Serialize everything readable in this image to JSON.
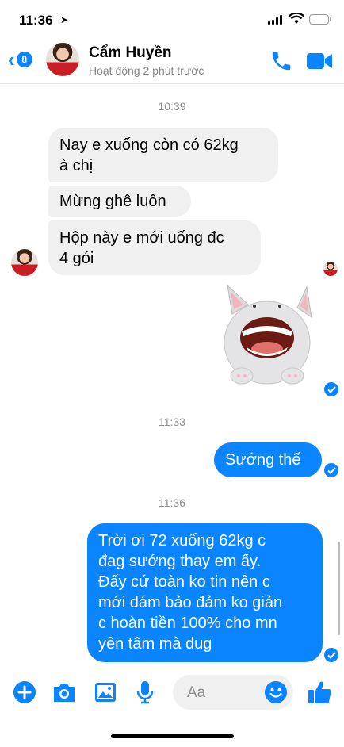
{
  "status_bar": {
    "time": "11:36"
  },
  "header": {
    "back_badge": "8",
    "contact_name": "Cẩm Huyền",
    "contact_status": "Hoạt động 2 phút trước"
  },
  "messages": {
    "timestamp_1": "10:39",
    "recv_1_line1": "Nay e xuống còn có 62kg",
    "recv_1_line2": "à chị",
    "recv_2": "Mừng ghê luôn",
    "recv_3_line1": "Hộp này e mới uống đc",
    "recv_3_line2": "4 gói",
    "timestamp_2": "11:33",
    "sent_1": "Sướng thế",
    "timestamp_3": "11:36",
    "sent_2_lines": [
      "Trời ơi 72 xuống 62kg c",
      "đag sướng thay em ấy.",
      "Đấy cứ toàn ko tin nên c",
      "mới dám bảo đảm ko giản",
      "c hoàn tiền 100% cho mn",
      "yên tâm mà dug"
    ]
  },
  "composer": {
    "placeholder": "Aa"
  },
  "colors": {
    "accent": "#0a84ff",
    "received_bubble": "#f1f0f0"
  }
}
